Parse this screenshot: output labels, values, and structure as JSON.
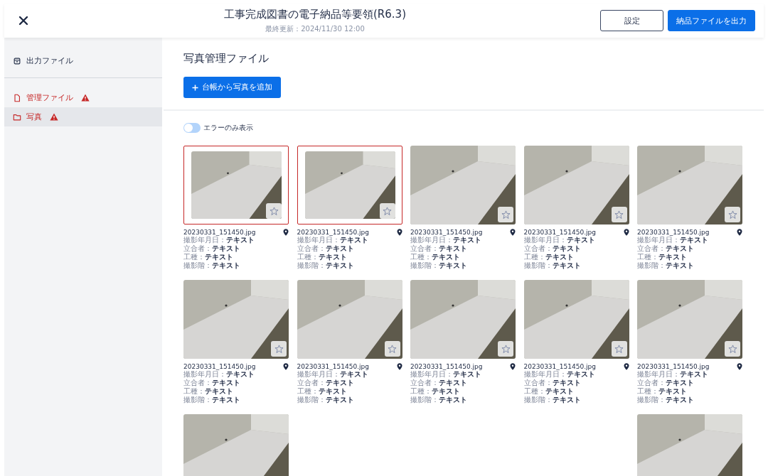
{
  "header": {
    "title": "工事完成図書の電子納品等要領(R6.3)",
    "subtitle": "最終更新：2024/11/30 12:00",
    "buttons": [
      {
        "label": "設定",
        "kind": "outline"
      },
      {
        "label": "納品ファイルを出力",
        "kind": "primary"
      }
    ]
  },
  "sidebar": {
    "groups": [
      [
        {
          "label": "出力ファイル",
          "error": false,
          "selected": false
        }
      ],
      [
        {
          "label": "管理ファイル",
          "error": true,
          "selected": false
        },
        {
          "label": "写真",
          "error": true,
          "selected": true
        }
      ]
    ]
  },
  "main": {
    "title": "写真管理ファイル",
    "add_button": "台帳から写真を追加",
    "filter": {
      "label": "エラーのみ表示",
      "on": false
    },
    "rows": [
      [
        {
          "filename": "20230331_151450.jpg",
          "error": true,
          "favorite": false,
          "details": [
            "撮影年月日：**テキスト**",
            "立合者：**テキスト**",
            "工種：**テキスト**",
            "撮影階：**テキスト**"
          ]
        },
        {
          "filename": "20230331_151450.jpg",
          "error": true,
          "favorite": false,
          "details": [
            "撮影年月日：**テキスト**",
            "立合者：**テキスト**",
            "工種：**テキスト**",
            "撮影階：**テキスト**"
          ]
        },
        {
          "filename": "20230331_151450.jpg",
          "error": false,
          "favorite": false,
          "details": [
            "撮影年月日：**テキスト**",
            "立合者：**テキスト**",
            "工種：**テキスト**",
            "撮影階：**テキスト**"
          ]
        },
        {
          "filename": "20230331_151450.jpg",
          "error": false,
          "favorite": false,
          "details": [
            "撮影年月日：**テキスト**",
            "立合者：**テキスト**",
            "工種：**テキスト**",
            "撮影階：**テキスト**"
          ]
        },
        {
          "filename": "20230331_151450.jpg",
          "error": false,
          "favorite": false,
          "details": [
            "撮影年月日：**テキスト**",
            "立合者：**テキスト**",
            "工種：**テキスト**",
            "撮影階：**テキスト**"
          ]
        }
      ],
      [
        {
          "filename": "20230331_151450.jpg",
          "error": false,
          "favorite": false,
          "details": [
            "撮影年月日：**テキスト**",
            "立合者：**テキスト**",
            "工種：**テキスト**",
            "撮影階：**テキスト**"
          ]
        },
        {
          "filename": "20230331_151450.jpg",
          "error": false,
          "favorite": false,
          "details": [
            "撮影年月日：**テキスト**",
            "立合者：**テキスト**",
            "工種：**テキスト**",
            "撮影階：**テキスト**"
          ]
        },
        {
          "filename": "20230331_151450.jpg",
          "error": false,
          "favorite": false,
          "details": [
            "撮影年月日：**テキスト**",
            "立合者：**テキスト**",
            "工種：**テキスト**",
            "撮影階：**テキスト**"
          ]
        },
        {
          "filename": "20230331_151450.jpg",
          "error": false,
          "favorite": false,
          "details": [
            "撮影年月日：**テキスト**",
            "立合者：**テキスト**",
            "工種：**テキスト**",
            "撮影階：**テキスト**"
          ]
        },
        {
          "filename": "20230331_151450.jpg",
          "error": false,
          "favorite": false,
          "details": [
            "撮影年月日：**テキスト**",
            "立合者：**テキスト**",
            "工種：**テキスト**",
            "撮影階：**テキスト**"
          ]
        }
      ],
      [
        {
          "error": false
        },
        null,
        null,
        null,
        {
          "error": false
        }
      ]
    ]
  }
}
